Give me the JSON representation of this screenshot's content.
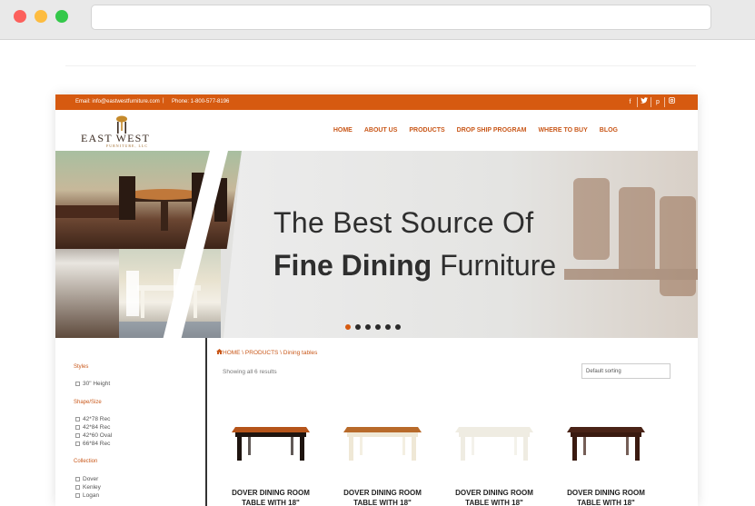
{
  "browser": {
    "address": ""
  },
  "topbar": {
    "email": "Email: info@eastwestfurniture.com",
    "separator": "|",
    "phone": "Phone: 1-800-577-8196",
    "social": [
      "f",
      "t",
      "p",
      "ig"
    ]
  },
  "logo": {
    "word": "EAST WEST",
    "sub": "FURNITURE, LLC"
  },
  "nav": [
    "HOME",
    "ABOUT US",
    "PRODUCTS",
    "DROP SHIP PROGRAM",
    "WHERE TO BUY",
    "BLOG"
  ],
  "hero": {
    "line1": "The Best Source Of",
    "line2_bold": "Fine Dining",
    "line2_rest": " Furniture",
    "slide_count": 6,
    "active_slide": 0
  },
  "breadcrumb": "HOME \\ PRODUCTS \\ Dining tables",
  "results": "Showing all 6 results",
  "sort": "Default sorting",
  "sidebar": {
    "styles_title": "Styles",
    "styles": [
      "30\" Height"
    ],
    "shape_title": "Shape/Size",
    "shapes": [
      "42*78 Rec",
      "42*84 Rec",
      "42*60 Oval",
      "66*84 Rec"
    ],
    "collection_title": "Collection",
    "collections": [
      "Dover",
      "Kenley",
      "Logan"
    ]
  },
  "products": [
    {
      "title": "DOVER DINING ROOM TABLE WITH 18\"",
      "top": "#b5541a",
      "legs": "#1e140f"
    },
    {
      "title": "DOVER DINING ROOM TABLE WITH 18\"",
      "top": "#b86a2a",
      "legs": "#efe8d6"
    },
    {
      "title": "DOVER DINING ROOM TABLE WITH 18\"",
      "top": "#efece2",
      "legs": "#efece2"
    },
    {
      "title": "DOVER DINING ROOM TABLE WITH 18\"",
      "top": "#4a2317",
      "legs": "#3a1a10"
    }
  ],
  "colors": {
    "accent": "#d65a10"
  }
}
